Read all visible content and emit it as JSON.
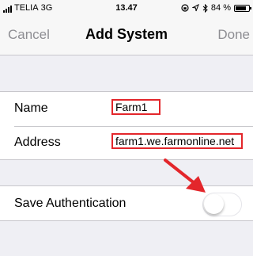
{
  "status_bar": {
    "carrier": "TELIA",
    "network": "3G",
    "time": "13.47",
    "battery_percent": "84 %",
    "battery_level": 0.84
  },
  "nav": {
    "cancel_label": "Cancel",
    "title": "Add System",
    "done_label": "Done"
  },
  "form": {
    "name_label": "Name",
    "name_value": "Farm1",
    "address_label": "Address",
    "address_value": "farm1.we.farmonline.net"
  },
  "settings": {
    "save_auth_label": "Save Authentication",
    "save_auth_enabled": false
  },
  "colors": {
    "highlight": "#e3262b",
    "arrow": "#e3262b"
  }
}
